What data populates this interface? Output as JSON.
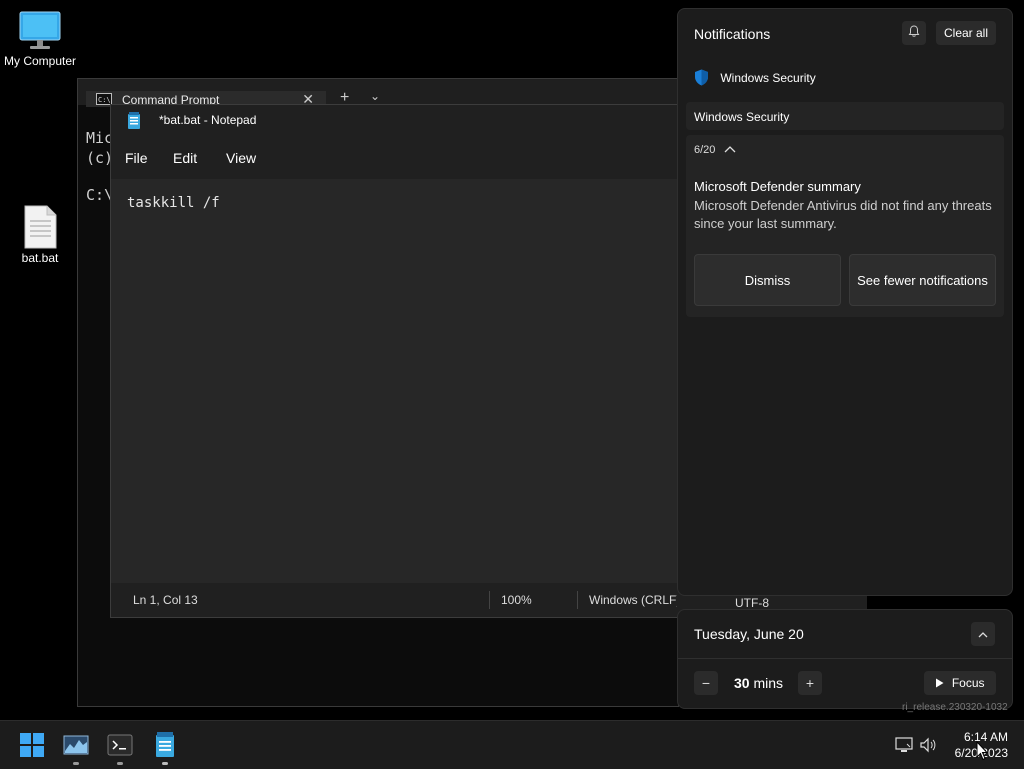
{
  "desktop": {
    "icons": [
      {
        "label": "My Computer"
      },
      {
        "label": "bat.bat"
      }
    ]
  },
  "cmd": {
    "tab_title": "Command Prompt",
    "close": "✕",
    "new_tab": "+",
    "dropdown": "⌄",
    "lines": [
      "Mic",
      "(c)",
      "C:\\"
    ]
  },
  "notepad": {
    "title": "*bat.bat - Notepad",
    "menu": [
      "File",
      "Edit",
      "View"
    ],
    "content": "taskkill /f",
    "status": {
      "position": "Ln 1, Col 13",
      "zoom": "100%",
      "line_ending": "Windows (CRLF)",
      "encoding": "UTF-8"
    }
  },
  "notifications": {
    "title": "Notifications",
    "clear_all": "Clear all",
    "app_name": "Windows Security",
    "group_header": "Windows Security",
    "card": {
      "date": "6/20",
      "title": "Microsoft Defender summary",
      "body": "Microsoft Defender Antivirus did not find any threats since your last summary.",
      "dismiss": "Dismiss",
      "see_fewer": "See fewer notifications"
    }
  },
  "calendar": {
    "date": "Tuesday, June 20",
    "minus": "−",
    "plus": "+",
    "focus_minutes": "30",
    "focus_unit": "mins",
    "focus_button": "Focus"
  },
  "taskbar": {
    "time": "6:14 AM",
    "date": "6/20/2023",
    "faint_text": "ri_release.230320-1032"
  }
}
